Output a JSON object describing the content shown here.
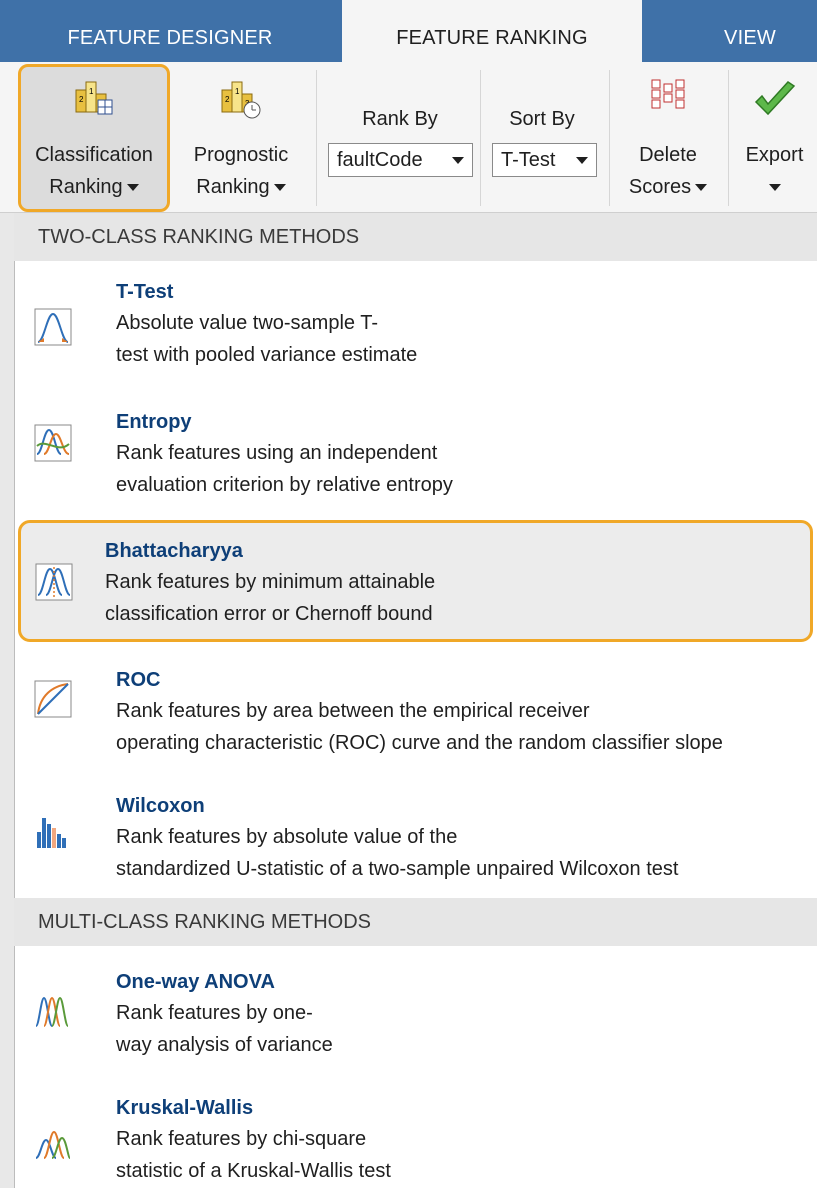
{
  "tabs": [
    {
      "label": "FEATURE DESIGNER",
      "active": false
    },
    {
      "label": "FEATURE RANKING",
      "active": true
    },
    {
      "label": "VIEW",
      "active": false
    }
  ],
  "toolstrip": {
    "classification_ranking": {
      "line1": "Classification",
      "line2": "Ranking",
      "icon": "ranking-table-icon"
    },
    "prognostic_ranking": {
      "line1": "Prognostic",
      "line2": "Ranking",
      "icon": "ranking-clock-icon"
    },
    "rank_by": {
      "label": "Rank By",
      "value": "faultCode"
    },
    "sort_by": {
      "label": "Sort By",
      "value": "T-Test"
    },
    "delete_scores": {
      "line1": "Delete",
      "line2": "Scores",
      "icon": "delete-scores-icon"
    },
    "export": {
      "label": "Export",
      "icon": "checkmark-icon"
    }
  },
  "menu": {
    "two_class_header": "TWO-CLASS RANKING METHODS",
    "multi_class_header": "MULTI-CLASS RANKING METHODS",
    "two_class_items": [
      {
        "title": "T-Test",
        "desc1": "Absolute value two-sample T-",
        "desc2": "test with pooled variance estimate",
        "icon": "t-test-icon"
      },
      {
        "title": "Entropy",
        "desc1": "Rank features using an independent",
        "desc2": "evaluation criterion by relative entropy",
        "icon": "entropy-icon"
      },
      {
        "title": "Bhattacharyya",
        "desc1": "Rank features by minimum attainable",
        "desc2": "classification error or Chernoff bound",
        "icon": "bhattacharyya-icon"
      },
      {
        "title": "ROC",
        "desc1": "Rank features by area between the empirical receiver",
        "desc2": "operating characteristic (ROC) curve and the random classifier slope",
        "icon": "roc-icon"
      },
      {
        "title": "Wilcoxon",
        "desc1": "Rank features by absolute value of the",
        "desc2": "standardized U-statistic of a two-sample unpaired Wilcoxon test",
        "icon": "wilcoxon-icon"
      }
    ],
    "multi_class_items": [
      {
        "title": "One-way ANOVA",
        "desc1": "Rank features by one-",
        "desc2": "way analysis of variance",
        "icon": "anova-icon"
      },
      {
        "title": "Kruskal-Wallis",
        "desc1": "Rank features by chi-square",
        "desc2": "statistic of a Kruskal-Wallis test",
        "icon": "kruskal-wallis-icon"
      }
    ]
  },
  "colors": {
    "tab_bar": "#3f71a8",
    "highlight_border": "#f0a828",
    "title_blue": "#0e3f78"
  }
}
